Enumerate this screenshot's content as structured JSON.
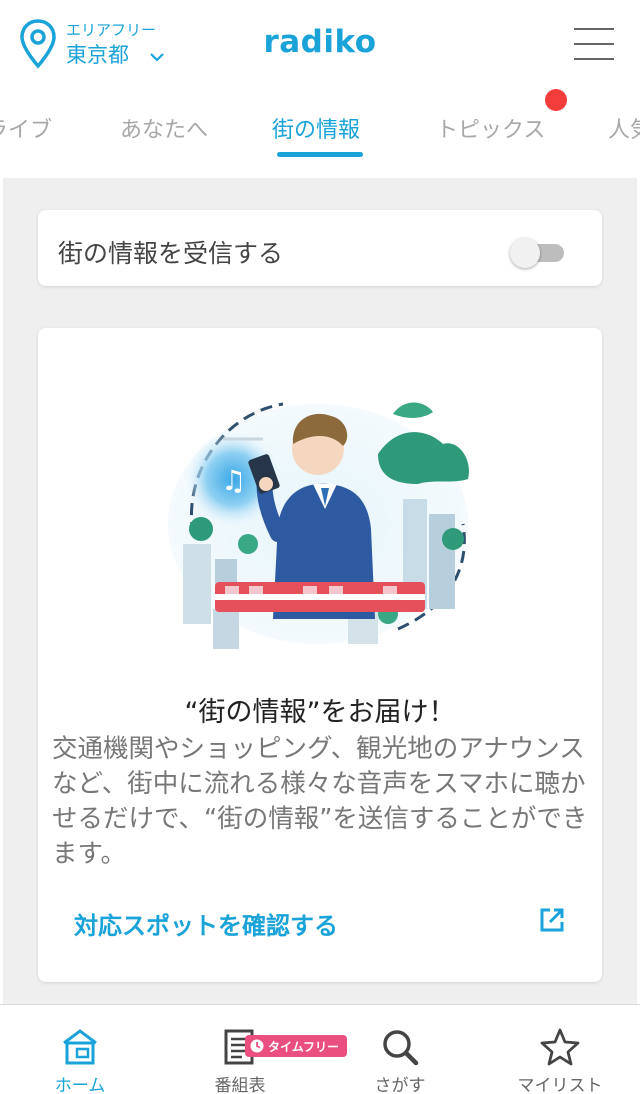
{
  "header": {
    "area_mode": "エリアフリー",
    "area_prefecture": "東京都",
    "logo": "radiko"
  },
  "tabs": [
    {
      "label": "ライブ",
      "active": false
    },
    {
      "label": "あなたへ",
      "active": false
    },
    {
      "label": "街の情報",
      "active": true
    },
    {
      "label": "トピックス",
      "active": false,
      "has_badge": true
    },
    {
      "label": "人気",
      "active": false
    }
  ],
  "toggle_card": {
    "label": "街の情報を受信する",
    "enabled": false
  },
  "info_card": {
    "title": "“街の情報”をお届け！",
    "body": "交通機関やショッピング、観光地のアナウンスなど、街中に流れる様々な音声をスマホに聴かせるだけで、“街の情報”を送信することができます。",
    "link_label": "対応スポットを確認する"
  },
  "bottom_nav": {
    "items": [
      {
        "label": "ホーム",
        "icon": "home-icon",
        "active": true
      },
      {
        "label": "番組表",
        "icon": "program-guide-icon",
        "active": false
      },
      {
        "label": "さがす",
        "icon": "search-icon",
        "active": false
      },
      {
        "label": "マイリスト",
        "icon": "star-icon",
        "active": false
      }
    ],
    "timefree_badge": "タイムフリー"
  },
  "colors": {
    "accent": "#1aa3d9",
    "badge_red": "#f23c3c",
    "timefree_pink": "#ea4f7f",
    "background": "#efefef"
  }
}
